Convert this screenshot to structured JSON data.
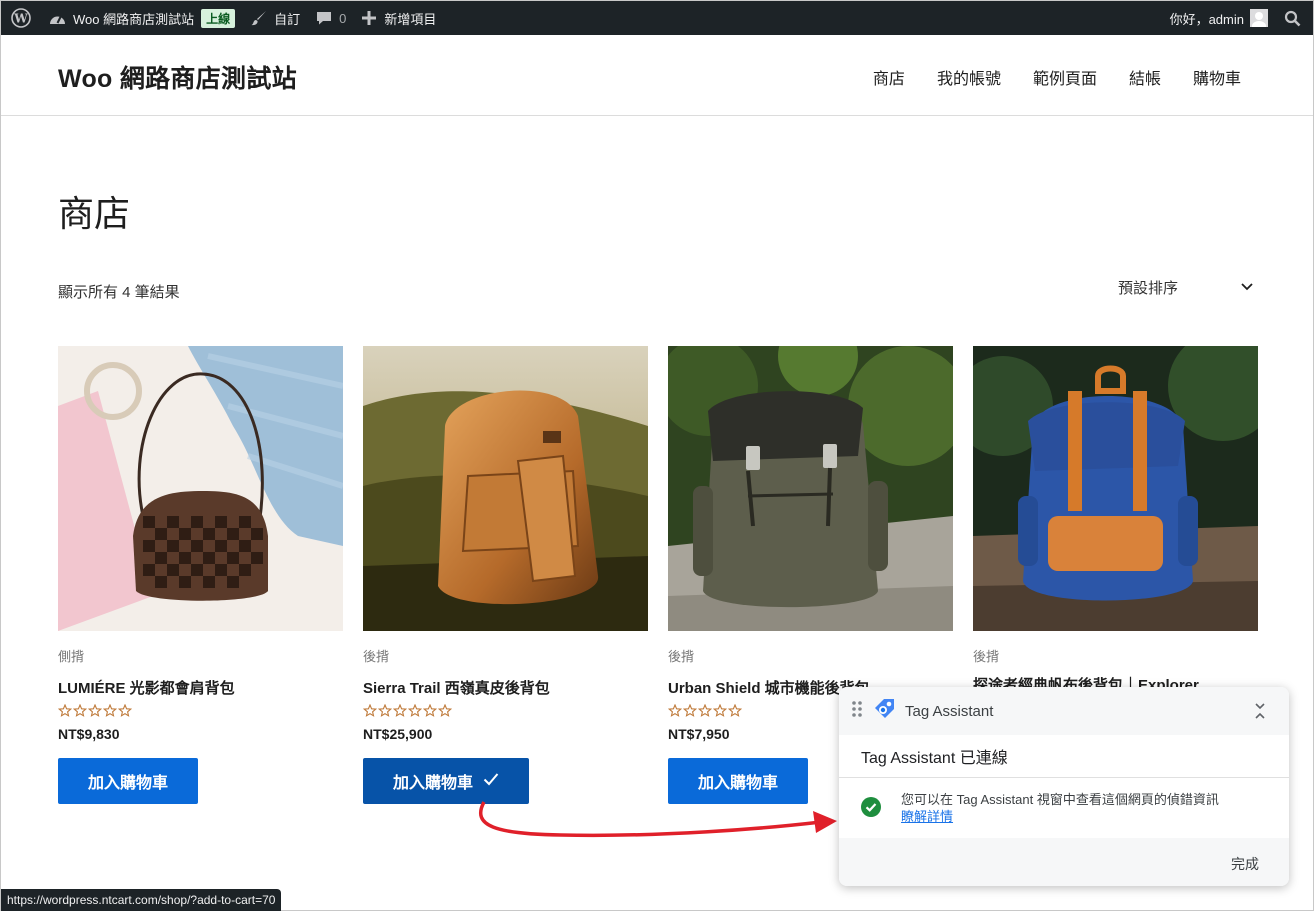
{
  "adminbar": {
    "site_name": "Woo 網路商店測試站",
    "live_badge": "上線",
    "customize": "自訂",
    "comments_count": "0",
    "new_item": "新增項目",
    "greeting": "你好，admin"
  },
  "header": {
    "site_title": "Woo 網路商店測試站",
    "nav": [
      "商店",
      "我的帳號",
      "範例頁面",
      "結帳",
      "購物車"
    ]
  },
  "page": {
    "title": "商店",
    "result_count": "顯示所有 4 筆結果",
    "orderby": "預設排序"
  },
  "products": [
    {
      "category": "側揹",
      "name": "LUMIÉRE 光影都會肩背包",
      "price": "NT$9,830",
      "button": "加入購物車",
      "added": false,
      "rating": 0
    },
    {
      "category": "後揹",
      "name": "Sierra Trail 西嶺真皮後背包",
      "price": "NT$25,900",
      "button": "加入購物車",
      "added": true,
      "rating": 0
    },
    {
      "category": "後揹",
      "name": "Urban Shield 城市機能後背包",
      "price": "NT$7,950",
      "button": "加入購物車",
      "added": false,
      "rating": 0
    },
    {
      "category": "後揹",
      "name": "探途者經典帆布後背包｜Explorer",
      "price": "",
      "button": "",
      "added": false,
      "rating": 0
    }
  ],
  "tag_assistant": {
    "title": "Tag Assistant",
    "status": "Tag Assistant 已連線",
    "message": "您可以在 Tag Assistant 視窗中查看這個網頁的偵錯資訊",
    "link": "瞭解詳情",
    "done": "完成"
  },
  "statusbar": {
    "url": "https://wordpress.ntcart.com/shop/?add-to-cart=70"
  },
  "colors": {
    "button": "#0a6ad9",
    "button_added": "#0753a8",
    "adminbar": "#1d2327",
    "star": "#bf7a3a",
    "arrow": "#e0202a"
  }
}
